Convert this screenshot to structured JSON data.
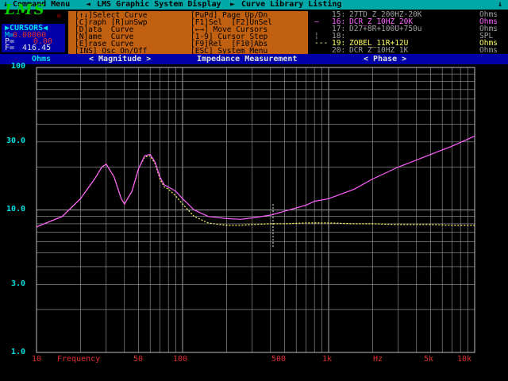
{
  "menubar": {
    "arrow1": "↓",
    "command_menu": "Command Menu",
    "arrow2": "◄",
    "title": "LMS Graphic System Display",
    "arrow3": "►",
    "curve_library": "Curve Library Listing",
    "arrow4": "↓"
  },
  "logo": {
    "text": "LMS",
    "mark": "®"
  },
  "cursors": {
    "title": "▶CURSORS◀",
    "m_label": "M=",
    "m_value": "0.00000",
    "p_label": "P=",
    "p_value": "0.00",
    "f_label": "F=",
    "f_value": "416.45"
  },
  "command_menu": {
    "left": [
      "[↑↓]Select Curve",
      "[C]raph [R]unSwp",
      "[D]ata  Curve",
      "[N]ame  Curve",
      "[E]rase Curve",
      "[INS] Osc On/Off"
    ],
    "right": [
      "[PuPd] Page Up/Dn",
      "[F1]Sel  [F2]UnSel",
      "[←→] Move Cursors",
      "[1-9] Cursor Step",
      "[F9]Rel  [F10]Abs",
      "[ESC] System Menu"
    ]
  },
  "library": [
    {
      "marker": "",
      "num": "15:",
      "name": "27TD_Z_200HZ-20K",
      "unit": "Ohms",
      "color": "#a0a0a0"
    },
    {
      "marker": "—",
      "num": "16:",
      "name": "DCR_Z_10HZ_20K",
      "unit": "Ohms",
      "color": "#ff60ff"
    },
    {
      "marker": "",
      "num": "17:",
      "name": "D27+8R+100U+750u",
      "unit": "Ohms",
      "color": "#a0a0a0"
    },
    {
      "marker": "¦",
      "num": "18:",
      "name": "",
      "unit": "SPL",
      "color": "#a0a0a0"
    },
    {
      "marker": "---",
      "num": "19:",
      "name": "ZOBEL_11R+12U",
      "unit": "Ohms",
      "color": "#ffff60"
    },
    {
      "marker": "",
      "num": "20:",
      "name": "DCR_Z_10HZ_1K",
      "unit": "Ohms",
      "color": "#a0a0a0"
    }
  ],
  "section": {
    "units": "Ohms",
    "magnitude": "< Magnitude >",
    "mode": "Impedance Measurement",
    "phase": "< Phase >"
  },
  "y_axis": {
    "labels": [
      "100",
      "30.0",
      "10.0",
      "3.0",
      "1.0"
    ]
  },
  "x_axis": {
    "labels": [
      "10",
      "Frequency",
      "50",
      "100",
      "500",
      "1k",
      "Hz",
      "5k",
      "10k"
    ]
  },
  "colors": {
    "curve_primary": "#ff60ff",
    "curve_secondary": "#ffff60",
    "grid": "#a0a0a0",
    "plot_bg": "#000000"
  },
  "chart_data": {
    "type": "line",
    "title": "Impedance Measurement",
    "xlabel": "Frequency",
    "ylabel": "Ohms",
    "xscale": "log",
    "yscale": "log",
    "xlim": [
      10,
      10000
    ],
    "ylim": [
      1,
      100
    ],
    "grid": true,
    "series": [
      {
        "name": "DCR_Z_10HZ_20K",
        "color": "#ff60ff",
        "x": [
          10,
          15,
          20,
          25,
          28,
          30,
          34,
          38,
          40,
          45,
          50,
          55,
          60,
          65,
          70,
          75,
          80,
          90,
          100,
          120,
          150,
          200,
          250,
          300,
          400,
          500,
          700,
          800,
          1000,
          1500,
          2000,
          3000,
          5000,
          7000,
          10000
        ],
        "y": [
          7.6,
          9.0,
          12.0,
          16.5,
          20.0,
          21.0,
          17.0,
          12.0,
          11.0,
          13.5,
          19.5,
          24.0,
          24.5,
          21.5,
          17.0,
          15.0,
          14.5,
          13.5,
          12.0,
          10.0,
          9.0,
          8.7,
          8.6,
          8.8,
          9.2,
          9.8,
          10.8,
          11.5,
          12.0,
          14.0,
          16.5,
          20.0,
          24.5,
          28.0,
          33.0
        ]
      },
      {
        "name": "ZOBEL_11R+12U",
        "color": "#ffff60",
        "x": [
          10,
          15,
          20,
          25,
          28,
          30,
          34,
          38,
          40,
          45,
          50,
          55,
          60,
          65,
          70,
          75,
          80,
          90,
          100,
          120,
          150,
          200,
          250,
          300,
          400,
          500,
          700,
          1000,
          1500,
          2000,
          3000,
          5000,
          7000,
          10000
        ],
        "y": [
          7.6,
          9.0,
          12.0,
          16.5,
          20.0,
          21.0,
          17.0,
          12.0,
          11.0,
          13.5,
          19.5,
          23.5,
          24.0,
          21.0,
          16.5,
          14.5,
          14.0,
          12.5,
          11.0,
          9.0,
          8.1,
          7.8,
          7.8,
          7.9,
          8.0,
          8.0,
          8.1,
          8.1,
          8.0,
          8.0,
          7.9,
          7.9,
          7.8,
          7.8
        ]
      }
    ]
  }
}
